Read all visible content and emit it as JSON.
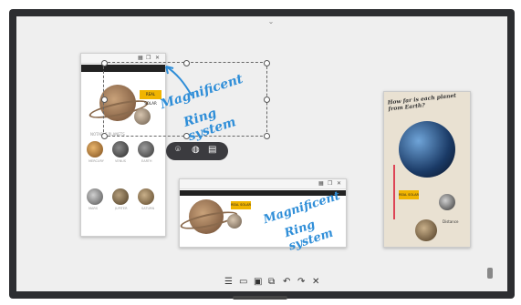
{
  "toolbar_top": {
    "collapse_icon": "chevron-down-icon"
  },
  "left_doc": {
    "topbar_icons": [
      "grid-icon",
      "copy-icon",
      "close-icon"
    ],
    "headline": "REAL SOLAR",
    "section_label": "NOTABLE PLANETS",
    "thumb_labels": [
      "MERCURY",
      "VENUS",
      "EARTH",
      "MARS",
      "JUPITER",
      "SATURN"
    ]
  },
  "annotation": {
    "text_line1": "Magnificent",
    "text_line2": "Ring system"
  },
  "floating_bar": {
    "icons": [
      "camera-icon",
      "globe-icon",
      "document-icon"
    ]
  },
  "mid_doc": {
    "headline": "REAL SOLAR"
  },
  "right_doc": {
    "title": "How far is each planet from Earth?",
    "labels": [
      "REAL SOLAR",
      "Distance"
    ]
  },
  "bottom_toolbar": {
    "icons": [
      "list-icon",
      "sticky-note-icon",
      "board-icon",
      "duplicate-icon",
      "undo-icon",
      "redo-icon",
      "close-icon"
    ]
  },
  "colors": {
    "annotation_blue": "#2f8ed8",
    "frame": "#2d2e31",
    "canvas": "#efefef"
  }
}
